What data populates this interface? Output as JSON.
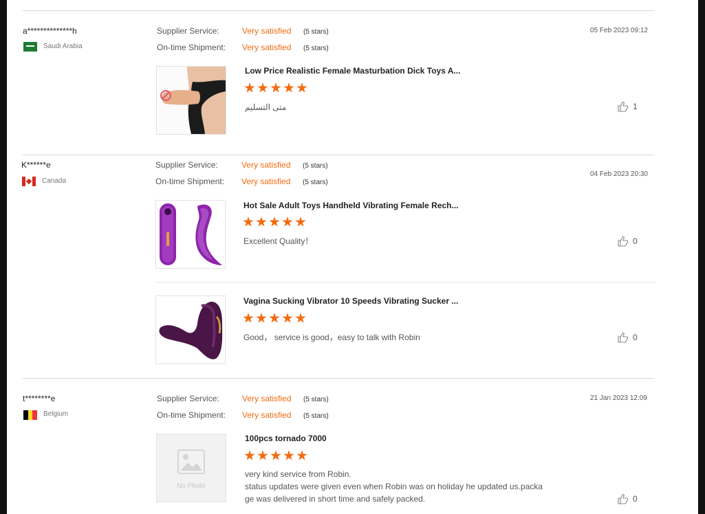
{
  "labels": {
    "supplier_service": "Supplier Service:",
    "ontime_shipment": "On-time Shipment:"
  },
  "reviews": [
    {
      "buyer": "a**************h",
      "country": "Saudi Arabia",
      "supplier_value": "Very satisfied",
      "supplier_stars": "(5 stars)",
      "shipment_value": "Very satisfied",
      "shipment_stars": "(5 stars)",
      "date": "05 Feb 2023 09:12",
      "products": [
        {
          "title": "Low Price Realistic Female Masturbation Dick Toys A...",
          "rating": 5,
          "comment": "متى التسليم",
          "likes": "1"
        }
      ]
    },
    {
      "buyer": "K******e",
      "country": "Canada",
      "supplier_value": "Very satisfied",
      "supplier_stars": "(5 stars)",
      "shipment_value": "Very satisfied",
      "shipment_stars": "(5 stars)",
      "date": "04 Feb 2023 20:30",
      "products": [
        {
          "title": "Hot Sale Adult Toys Handheld Vibrating Female Rech...",
          "rating": 5,
          "comment": "Excellent Quality！",
          "likes": "0"
        },
        {
          "title": "Vagina Sucking Vibrator 10 Speeds Vibrating Sucker ...",
          "rating": 5,
          "comment": "Good，  service is good，easy to talk with Robin",
          "likes": "0"
        }
      ]
    },
    {
      "buyer": "t********e",
      "country": "Belgium",
      "supplier_value": "Very satisfied",
      "supplier_stars": "(5 stars)",
      "shipment_value": "Very satisfied",
      "shipment_stars": "(5 stars)",
      "date": "21 Jan 2023 12:09",
      "products": [
        {
          "title": "100pcs tornado 7000",
          "rating": 5,
          "comment_lines": [
            "very kind service from Robin.",
            "status updates were given even when Robin was on holiday he updated us.packa",
            "ge was delivered in short time and safely packed."
          ],
          "likes": "0",
          "no_photo_label": "No Photo"
        }
      ]
    }
  ],
  "colors": {
    "accent": "#f26b10",
    "divider": "#d9d9d9",
    "flag_saudi": "#1e7a34",
    "flag_canada": "#d52b1e",
    "flag_belgium": [
      "#000000",
      "#fdda24",
      "#ef3340"
    ],
    "product_purple": "#7b1fa2"
  },
  "icons": {
    "like": "thumbs-up-icon",
    "flag_sa": "saudi-arabia-flag-icon",
    "flag_ca": "canada-flag-icon",
    "flag_be": "belgium-flag-icon",
    "no_photo": "image-placeholder-icon"
  }
}
